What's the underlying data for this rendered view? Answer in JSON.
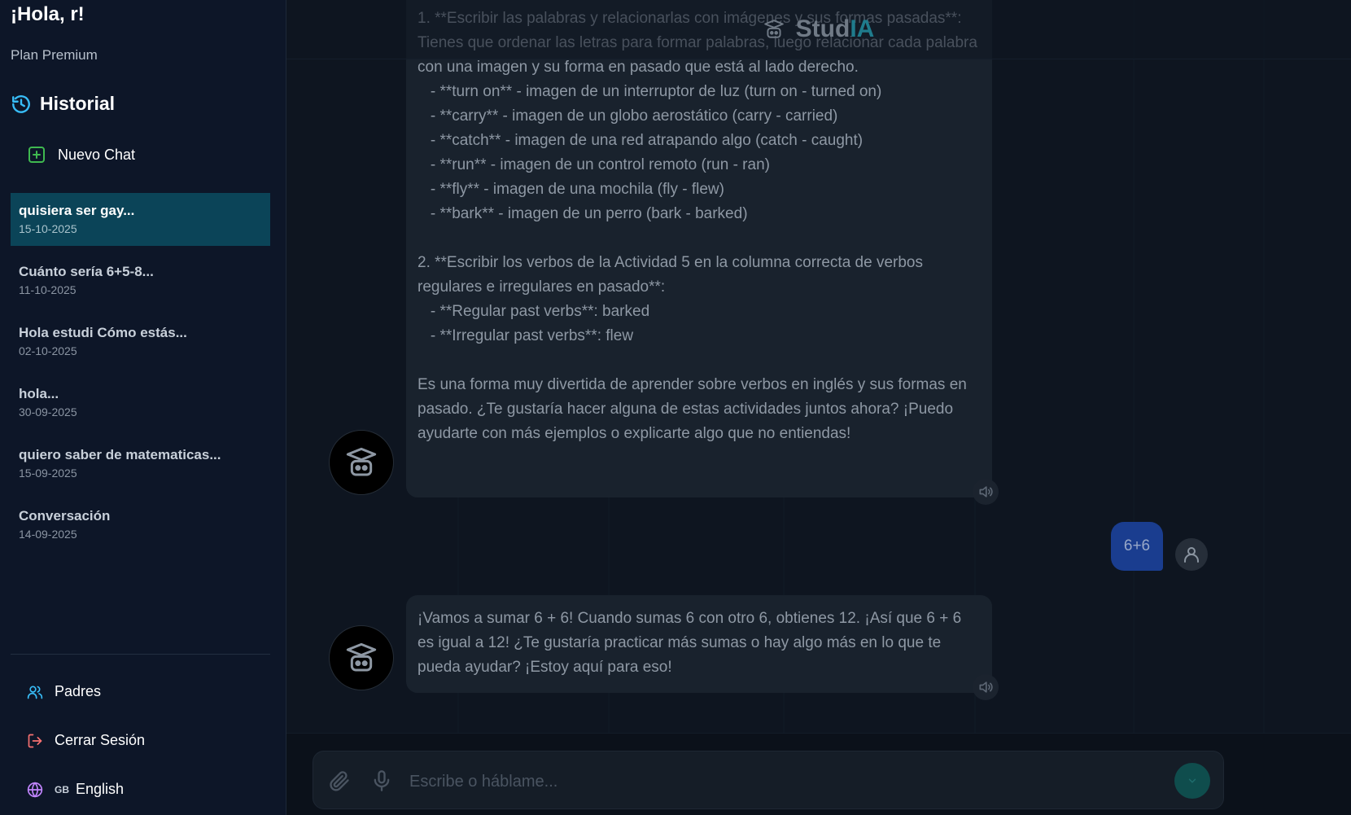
{
  "sidebar": {
    "greeting": "¡Hola, r!",
    "plan": "Plan Premium",
    "history_title": "Historial",
    "new_chat_label": "Nuevo Chat",
    "chats": [
      {
        "title": "quisiera ser gay...",
        "date": "15-10-2025",
        "active": true
      },
      {
        "title": "Cuánto sería 6+5-8...",
        "date": "11-10-2025",
        "active": false
      },
      {
        "title": "Hola estudi Cómo estás...",
        "date": "02-10-2025",
        "active": false
      },
      {
        "title": "hola...",
        "date": "30-09-2025",
        "active": false
      },
      {
        "title": "quiero saber de matematicas...",
        "date": "15-09-2025",
        "active": false
      },
      {
        "title": "Conversación",
        "date": "14-09-2025",
        "active": false
      }
    ],
    "parents_label": "Padres",
    "logout_label": "Cerrar Sesión",
    "language_code": "GB",
    "language_label": "English"
  },
  "header": {
    "brand_part1": "Stud",
    "brand_part2": "IA"
  },
  "messages": {
    "bot_1": "1. **Escribir las palabras y relacionarlas con imágenes y sus formas pasadas**: Tienes que ordenar las letras para formar palabras, luego relacionar cada palabra con una imagen y su forma en pasado que está al lado derecho.\n   - **turn on** - imagen de un interruptor de luz (turn on - turned on)\n   - **carry** - imagen de un globo aerostático (carry - carried)\n   - **catch** - imagen de una red atrapando algo (catch - caught)\n   - **run** - imagen de un control remoto (run - ran)\n   - **fly** - imagen de una mochila (fly - flew)\n   - **bark** - imagen de un perro (bark - barked)\n\n2. **Escribir los verbos de la Actividad 5 en la columna correcta de verbos regulares e irregulares en pasado**:\n   - **Regular past verbs**: barked\n   - **Irregular past verbs**: flew\n\nEs una forma muy divertida de aprender sobre verbos en inglés y sus formas en pasado. ¿Te gustaría hacer alguna de estas actividades juntos ahora? ¡Puedo ayudarte con más ejemplos o explicarte algo que no entiendas!",
    "user_1": "6+6",
    "bot_2": "¡Vamos a sumar 6 + 6! Cuando sumas 6 con otro 6, obtienes 12. ¡Así que 6 + 6 es igual a 12! ¿Te gustaría practicar más sumas o hay algo más en lo que te pueda ayudar? ¡Estoy aquí para eso!"
  },
  "composer": {
    "placeholder": "Escribe o háblame..."
  },
  "colors": {
    "sidebar_bg": "#0d1628",
    "active_chat": "#0b4458",
    "brand_accent": "#1f7b8c",
    "user_bubble": "#1a3d8f",
    "new_chat_icon": "#3fb950",
    "parents_icon": "#38bdf8",
    "logout_icon": "#f87171",
    "language_icon": "#c084fc"
  },
  "icons": {
    "history": "history-icon",
    "new_chat": "plus-square-icon",
    "parents": "users-icon",
    "logout": "logout-icon",
    "language": "globe-icon",
    "brand": "graduation-robot-icon",
    "bot_avatar": "graduation-robot-icon",
    "speaker": "speaker-icon",
    "user_avatar": "user-icon",
    "attach": "paperclip-icon",
    "mic": "microphone-icon",
    "send": "send-icon"
  }
}
